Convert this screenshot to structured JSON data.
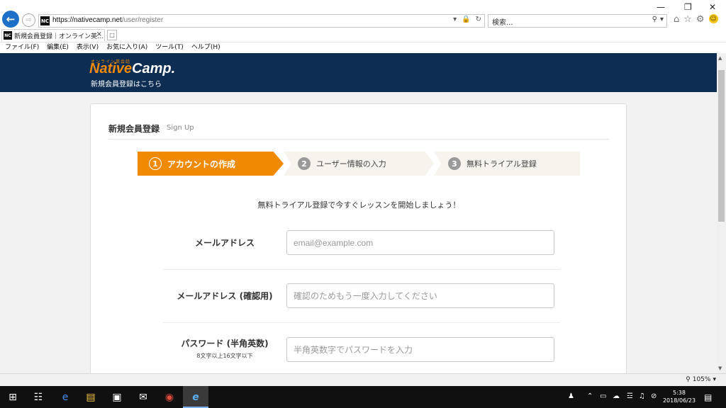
{
  "browser": {
    "url_host": "https://nativecamp.net",
    "url_path": "/user/register",
    "search_placeholder": "検索...",
    "tab_title": "新規会員登録｜オンライン英...",
    "favicon_text": "NC",
    "menu": [
      "ファイル(F)",
      "編集(E)",
      "表示(V)",
      "お気に入り(A)",
      "ツール(T)",
      "ヘルプ(H)"
    ],
    "zoom": "105%"
  },
  "site": {
    "logo_tagline": "オンライン英会話",
    "logo_part1": "Native",
    "logo_part2": "Camp.",
    "header_sub": "新規会員登録はこちら"
  },
  "form": {
    "title": "新規会員登録",
    "title_en": "Sign Up",
    "steps": [
      {
        "num": "1",
        "label": "アカウントの作成"
      },
      {
        "num": "2",
        "label": "ユーザー情報の入力"
      },
      {
        "num": "3",
        "label": "無料トライアル登録"
      }
    ],
    "intro": "無料トライアル登録で今すぐレッスンを開始しましょう！",
    "fields": [
      {
        "label": "メールアドレス",
        "placeholder": "email@example.com",
        "hint": ""
      },
      {
        "label": "メールアドレス (確認用)",
        "placeholder": "確認のためもう一度入力してください",
        "hint": ""
      },
      {
        "label": "パスワード (半角英数)",
        "placeholder": "半角英数字でパスワードを入力",
        "hint": "8文字以上16文字以下"
      }
    ]
  },
  "taskbar": {
    "time": "5:38",
    "date": "2018/06/23"
  },
  "colors": {
    "header_bg": "#0d2d52",
    "accent": "#f08a00",
    "ie_blue": "#1e6fc7"
  }
}
